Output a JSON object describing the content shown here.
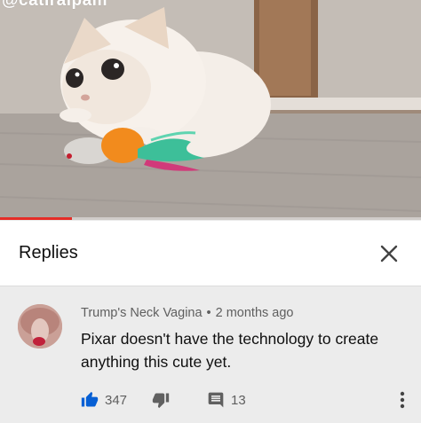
{
  "video": {
    "watermark": "@catiralpam",
    "progress_fraction": 0.17
  },
  "replies_panel": {
    "title": "Replies",
    "close_icon": "close-icon"
  },
  "comment": {
    "author": "Trump's Neck Vagina",
    "separator": "•",
    "timestamp": "2 months ago",
    "text": "Pixar doesn't have the technology to create anything this cute yet.",
    "likes": "347",
    "replies": "13",
    "icons": {
      "like": "thumbs-up-icon",
      "dislike": "thumbs-down-icon",
      "reply": "comment-icon",
      "more": "more-vert-icon"
    }
  },
  "colors": {
    "like_active": "#065fd4",
    "progress": "#e52d27",
    "panel_bg": "#ececec",
    "header_bg": "#ffffff"
  }
}
